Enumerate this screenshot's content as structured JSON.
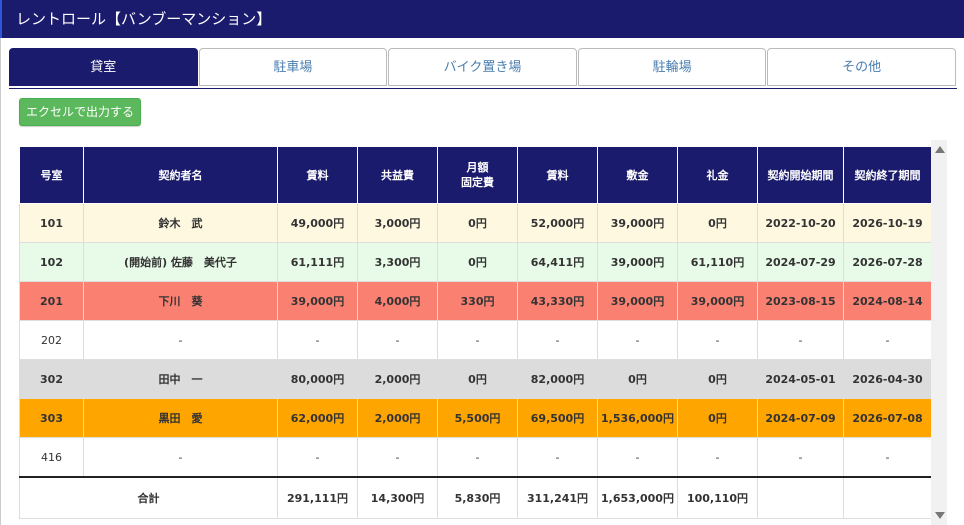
{
  "title": "レントロール【バンブーマンション】",
  "tabs": [
    "貸室",
    "駐車場",
    "バイク置き場",
    "駐輪場",
    "その他"
  ],
  "export_label": "エクセルで出力する",
  "columns": [
    "号室",
    "契約者名",
    "賃料",
    "共益費",
    "月額\n固定費",
    "賃料",
    "敷金",
    "礼金",
    "契約開始期間",
    "契約終了期間"
  ],
  "rows": [
    {
      "room": "101",
      "name": "鈴木　武",
      "rent": "49,000円",
      "common": "3,000円",
      "fixed": "0円",
      "total": "52,000円",
      "deposit": "39,000円",
      "key_money": "0円",
      "start": "2022-10-20",
      "end": "2026-10-19"
    },
    {
      "room": "102",
      "name": "(開始前) 佐藤　美代子",
      "rent": "61,111円",
      "common": "3,300円",
      "fixed": "0円",
      "total": "64,411円",
      "deposit": "39,000円",
      "key_money": "61,110円",
      "start": "2024-07-29",
      "end": "2026-07-28"
    },
    {
      "room": "201",
      "name": "下川　葵",
      "rent": "39,000円",
      "common": "4,000円",
      "fixed": "330円",
      "total": "43,330円",
      "deposit": "39,000円",
      "key_money": "39,000円",
      "start": "2023-08-15",
      "end": "2024-08-14"
    },
    {
      "room": "202",
      "name": "-",
      "rent": "-",
      "common": "-",
      "fixed": "-",
      "total": "-",
      "deposit": "-",
      "key_money": "-",
      "start": "-",
      "end": "-"
    },
    {
      "room": "302",
      "name": "田中　一",
      "rent": "80,000円",
      "common": "2,000円",
      "fixed": "0円",
      "total": "82,000円",
      "deposit": "0円",
      "key_money": "0円",
      "start": "2024-05-01",
      "end": "2026-04-30"
    },
    {
      "room": "303",
      "name": "黒田　愛",
      "rent": "62,000円",
      "common": "2,000円",
      "fixed": "5,500円",
      "total": "69,500円",
      "deposit": "1,536,000円",
      "key_money": "0円",
      "start": "2024-07-09",
      "end": "2026-07-08"
    },
    {
      "room": "416",
      "name": "-",
      "rent": "-",
      "common": "-",
      "fixed": "-",
      "total": "-",
      "deposit": "-",
      "key_money": "-",
      "start": "-",
      "end": "-"
    }
  ],
  "total_row": {
    "label": "合計",
    "rent": "291,111円",
    "common": "14,300円",
    "fixed": "5,830円",
    "total": "311,241円",
    "deposit": "1,653,000円",
    "key_money": "100,110円",
    "start": "",
    "end": ""
  }
}
